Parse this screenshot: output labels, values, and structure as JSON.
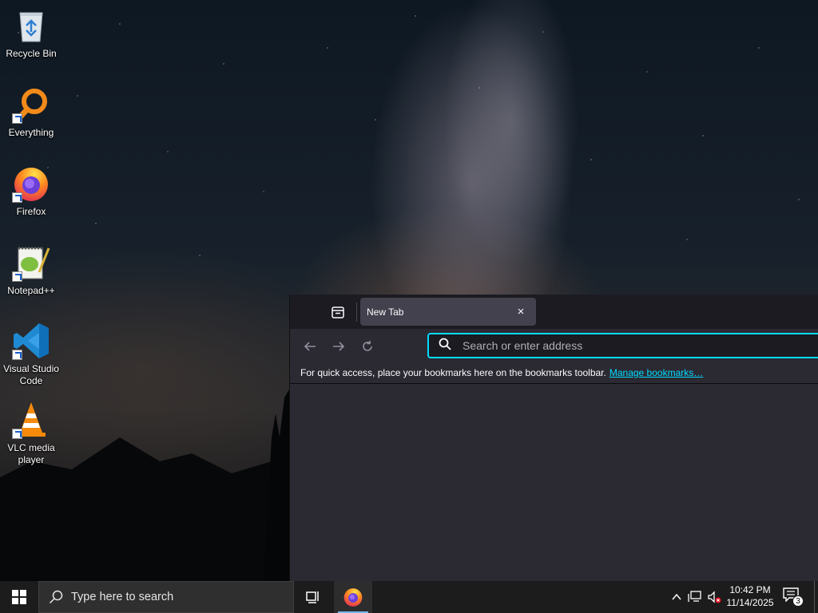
{
  "desktop": {
    "icons": [
      {
        "label": "Recycle Bin"
      },
      {
        "label": "Everything"
      },
      {
        "label": "Firefox"
      },
      {
        "label": "Notepad++"
      },
      {
        "label": "Visual Studio Code"
      },
      {
        "label": "VLC media player"
      }
    ]
  },
  "browser": {
    "tab": {
      "title": "New Tab",
      "close": "×"
    },
    "urlbar": {
      "placeholder": "Search or enter address"
    },
    "bookmarks_bar": {
      "text": "For quick access, place your bookmarks here on the bookmarks toolbar.",
      "link": "Manage bookmarks…"
    },
    "accent_color": "#00ddff"
  },
  "taskbar": {
    "search_placeholder": "Type here to search",
    "clock": {
      "time": "10:42 PM",
      "date": "11/14/2025"
    },
    "notification_count": "3"
  }
}
